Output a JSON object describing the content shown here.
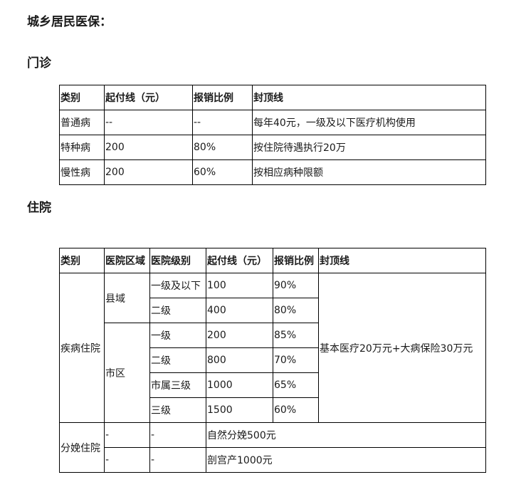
{
  "title": "城乡居民医保：",
  "outpatient": {
    "heading": "门诊",
    "headers": [
      "类别",
      "起付线（元）",
      "报销比例",
      "封顶线"
    ],
    "rows": [
      [
        "普通病",
        "--",
        "--",
        "每年40元，一级及以下医疗机构使用"
      ],
      [
        "特种病",
        "200",
        "80%",
        "按住院待遇执行20万"
      ],
      [
        "慢性病",
        "200",
        "60%",
        "按相应病种限额"
      ]
    ]
  },
  "inpatient": {
    "heading": "住院",
    "headers": [
      "类别",
      "医院区域",
      "医院级别",
      "起付线（元）",
      "报销比例",
      "封顶线"
    ],
    "disease": {
      "category": "疾病住院",
      "cap": "基本医疗20万元+大病保险30万元",
      "county": {
        "region": "县域",
        "rows": [
          [
            "一级及以下",
            "100",
            "90%"
          ],
          [
            "二级",
            "400",
            "80%"
          ]
        ]
      },
      "city": {
        "region": "市区",
        "rows": [
          [
            "一级",
            "200",
            "85%"
          ],
          [
            "二级",
            "800",
            "70%"
          ],
          [
            "市属三级",
            "1000",
            "65%"
          ],
          [
            "三级",
            "1500",
            "60%"
          ]
        ]
      }
    },
    "childbirth": {
      "category": "分娩住院",
      "rows": [
        [
          "-",
          "-",
          "自然分娩500元"
        ],
        [
          "-",
          "-",
          "剖宫产1000元"
        ]
      ]
    }
  }
}
